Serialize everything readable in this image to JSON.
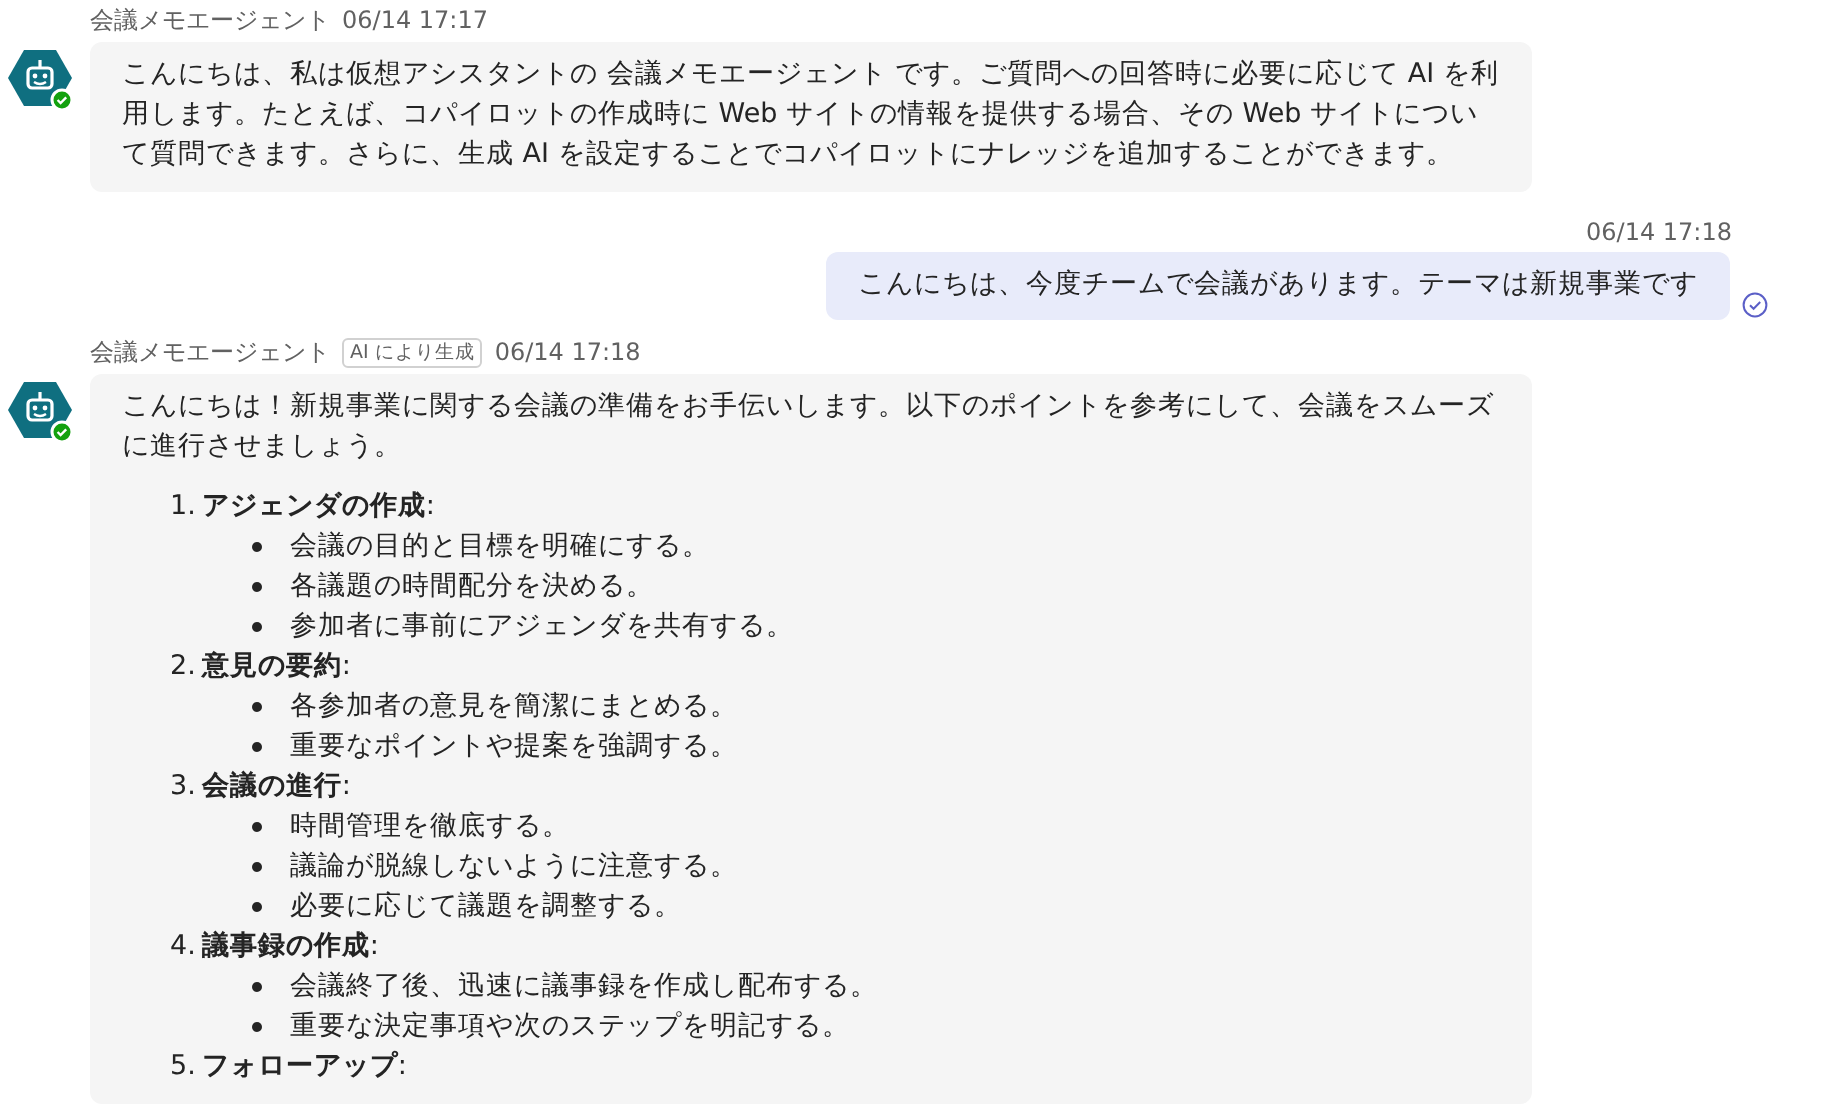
{
  "messages": [
    {
      "kind": "bot",
      "sender": "会議メモエージェント",
      "time": "06/14 17:17",
      "available": true,
      "text": "こんにちは、私は仮想アシスタントの 会議メモエージェント です。ご質問への回答時に必要に応じて AI を利用します。たとえば、コパイロットの作成時に Web サイトの情報を提供する場合、その Web サイトについて質問できます。さらに、生成 AI を設定することでコパイロットにナレッジを追加することができます。"
    },
    {
      "kind": "user",
      "time": "06/14 17:18",
      "seen": true,
      "text": "こんにちは、今度チームで会議があります。テーマは新規事業です"
    },
    {
      "kind": "bot",
      "sender": "会議メモエージェント",
      "badge": "AI により生成",
      "time": "06/14 17:18",
      "available": true,
      "text": "こんにちは！新規事業に関する会議の準備をお手伝いします。以下のポイントを参考にして、会議をスムーズに進行させましょう。",
      "sections": [
        {
          "number": "1.",
          "title": "**アジェンダの作成**:",
          "bullets": [
            "会議の目的と目標を明確にする。",
            "各議題の時間配分を決める。",
            "参加者に事前にアジェンダを共有する。"
          ]
        },
        {
          "number": "2.",
          "title": "**意見の要約**:",
          "bullets": [
            "各参加者の意見を簡潔にまとめる。",
            "重要なポイントや提案を強調する。"
          ]
        },
        {
          "number": "3.",
          "title": "**会議の進行**:",
          "bullets": [
            "時間管理を徹底する。",
            "議論が脱線しないように注意する。",
            "必要に応じて議題を調整する。"
          ]
        },
        {
          "number": "4.",
          "title": "**議事録の作成**:",
          "bullets": [
            "会議終了後、迅速に議事録を作成し配布する。",
            "重要な決定事項や次のステップを明記する。"
          ]
        },
        {
          "number": "5.",
          "title": "**フォローアップ**:"
        }
      ]
    }
  ]
}
